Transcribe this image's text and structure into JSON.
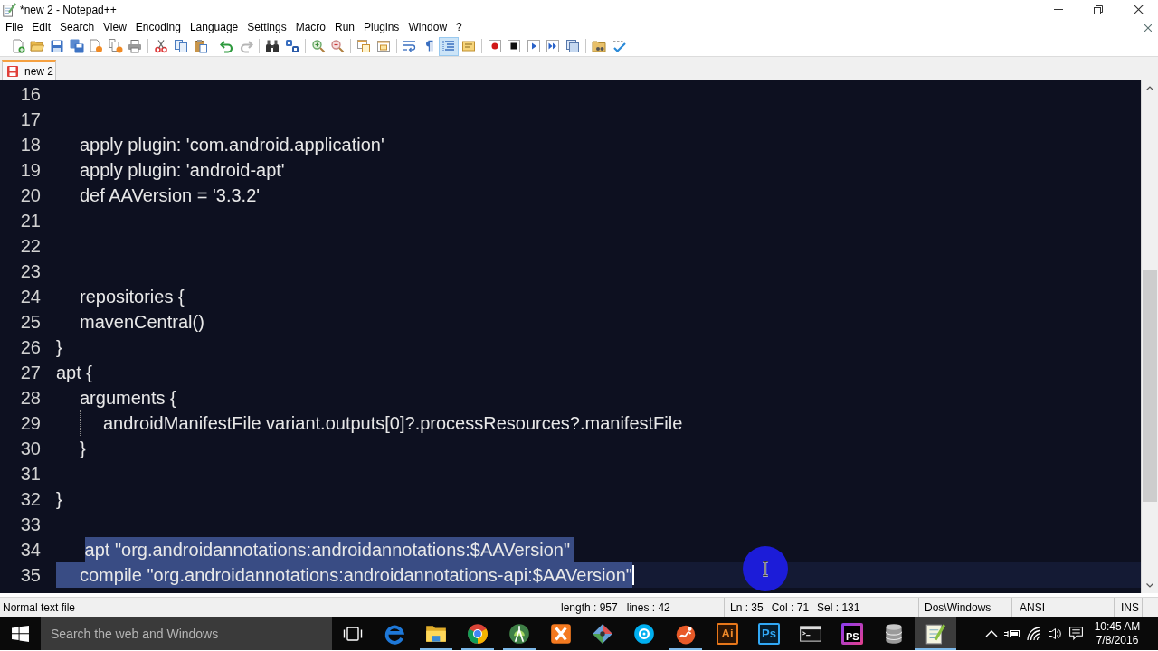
{
  "window": {
    "title": "*new 2 - Notepad++"
  },
  "menu": [
    "File",
    "Edit",
    "Search",
    "View",
    "Encoding",
    "Language",
    "Settings",
    "Macro",
    "Run",
    "Plugins",
    "Window",
    "?"
  ],
  "toolbar": [
    [
      {
        "pressed": false,
        "disabled": false
      },
      {
        "pressed": false,
        "disabled": false
      },
      {
        "pressed": false,
        "disabled": false
      },
      {
        "pressed": false,
        "disabled": false
      },
      {
        "pressed": false,
        "disabled": false
      },
      {
        "pressed": false,
        "disabled": false
      },
      {
        "pressed": false,
        "disabled": false
      }
    ],
    [
      {
        "pressed": false,
        "disabled": false
      },
      {
        "pressed": false,
        "disabled": false
      },
      {
        "pressed": false,
        "disabled": false
      }
    ],
    [
      {
        "pressed": false,
        "disabled": false
      },
      {
        "pressed": false,
        "disabled": true
      }
    ],
    [
      {
        "pressed": false,
        "disabled": false
      },
      {
        "pressed": false,
        "disabled": false
      }
    ],
    [
      {
        "pressed": false,
        "disabled": false
      },
      {
        "pressed": false,
        "disabled": false
      }
    ],
    [
      {
        "pressed": false,
        "disabled": false
      },
      {
        "pressed": false,
        "disabled": false
      }
    ],
    [
      {
        "pressed": false,
        "disabled": false
      },
      {
        "pressed": false,
        "disabled": false
      },
      {
        "pressed": true,
        "disabled": false
      },
      {
        "pressed": false,
        "disabled": false
      }
    ],
    [
      {
        "pressed": false,
        "disabled": false
      },
      {
        "pressed": false,
        "disabled": false
      },
      {
        "pressed": false,
        "disabled": false
      },
      {
        "pressed": false,
        "disabled": false
      },
      {
        "pressed": false,
        "disabled": false
      }
    ],
    [
      {
        "pressed": false,
        "disabled": false
      },
      {
        "pressed": false,
        "disabled": false
      }
    ]
  ],
  "tabs": [
    {
      "label": "new 2",
      "selected": true,
      "modified": true
    }
  ],
  "editor": {
    "lines": [
      {
        "number": "16",
        "selected": false,
        "current": false
      },
      {
        "number": "17",
        "selected": false,
        "current": false
      },
      {
        "number": "18",
        "text": "\tapply plugin: 'com.android.application'",
        "selected": false,
        "current": false
      },
      {
        "number": "19",
        "text": "\tapply plugin: 'android-apt'",
        "selected": false,
        "current": false
      },
      {
        "number": "20",
        "text": "\tdef AAVersion = '3.3.2'",
        "selected": false,
        "current": false
      },
      {
        "number": "21",
        "selected": false,
        "current": false
      },
      {
        "number": "22",
        "selected": false,
        "current": false
      },
      {
        "number": "23",
        "selected": false,
        "current": false
      },
      {
        "number": "24",
        "text": "\trepositories {",
        "selected": false,
        "current": false
      },
      {
        "number": "25",
        "text": "\tmavenCentral()",
        "selected": false,
        "current": false
      },
      {
        "number": "26",
        "text": "}",
        "selected": false,
        "current": false
      },
      {
        "number": "27",
        "text": "apt {",
        "selected": false,
        "current": false
      },
      {
        "number": "28",
        "text": "\targuments {",
        "selected": false,
        "current": false
      },
      {
        "number": "29",
        "text": "\t\tandroidManifestFile variant.outputs[0]?.processResources?.manifestFile",
        "selected": false,
        "current": false
      },
      {
        "number": "30",
        "text": "\t}",
        "selected": false,
        "current": false
      },
      {
        "number": "31",
        "selected": false,
        "current": false
      },
      {
        "number": "32",
        "text": "}",
        "selected": false,
        "current": false
      },
      {
        "number": "33",
        "selected": false,
        "current": false
      },
      {
        "number": "34",
        "text": "\t apt \"org.androidannotations:androidannotations:$AAVersion\"",
        "selected": true,
        "current": false
      },
      {
        "number": "35",
        "text": "\tcompile \"org.androidannotations:androidannotations-api:$AAVersion\"",
        "selected": true,
        "current": true
      }
    ]
  },
  "status_bar": {
    "file_type": "Normal text file",
    "length": "length : 957",
    "lines": "lines : 42",
    "ln": "Ln : 35",
    "col": "Col : 71",
    "sel": "Sel : 131",
    "eol": "Dos\\Windows",
    "encoding": "ANSI",
    "mode": "INS"
  },
  "taskbar": {
    "search": {
      "placeholder": "Search the web and Windows"
    },
    "apps": [
      {
        "kind": "icon",
        "running": false,
        "active": false
      },
      {
        "kind": "icon",
        "running": true,
        "active": false
      },
      {
        "kind": "icon",
        "running": true,
        "active": false
      },
      {
        "kind": "icon",
        "running": true,
        "active": false
      },
      {
        "kind": "icon",
        "running": false,
        "active": false
      },
      {
        "kind": "icon",
        "running": false,
        "active": false
      },
      {
        "kind": "icon",
        "running": false,
        "active": false
      },
      {
        "kind": "icon",
        "running": true,
        "active": false
      },
      {
        "kind": "tile",
        "label": "Ai",
        "running": false,
        "active": false
      },
      {
        "kind": "tile",
        "label": "Ps",
        "running": false,
        "active": false
      },
      {
        "kind": "icon",
        "running": false,
        "active": false
      },
      {
        "kind": "tile",
        "label": "PS",
        "running": false,
        "active": false
      },
      {
        "kind": "icon",
        "running": false,
        "active": false
      },
      {
        "kind": "icon",
        "running": true,
        "active": true
      }
    ],
    "clock": {
      "time": "10:45 AM",
      "date": "7/8/2016"
    }
  }
}
